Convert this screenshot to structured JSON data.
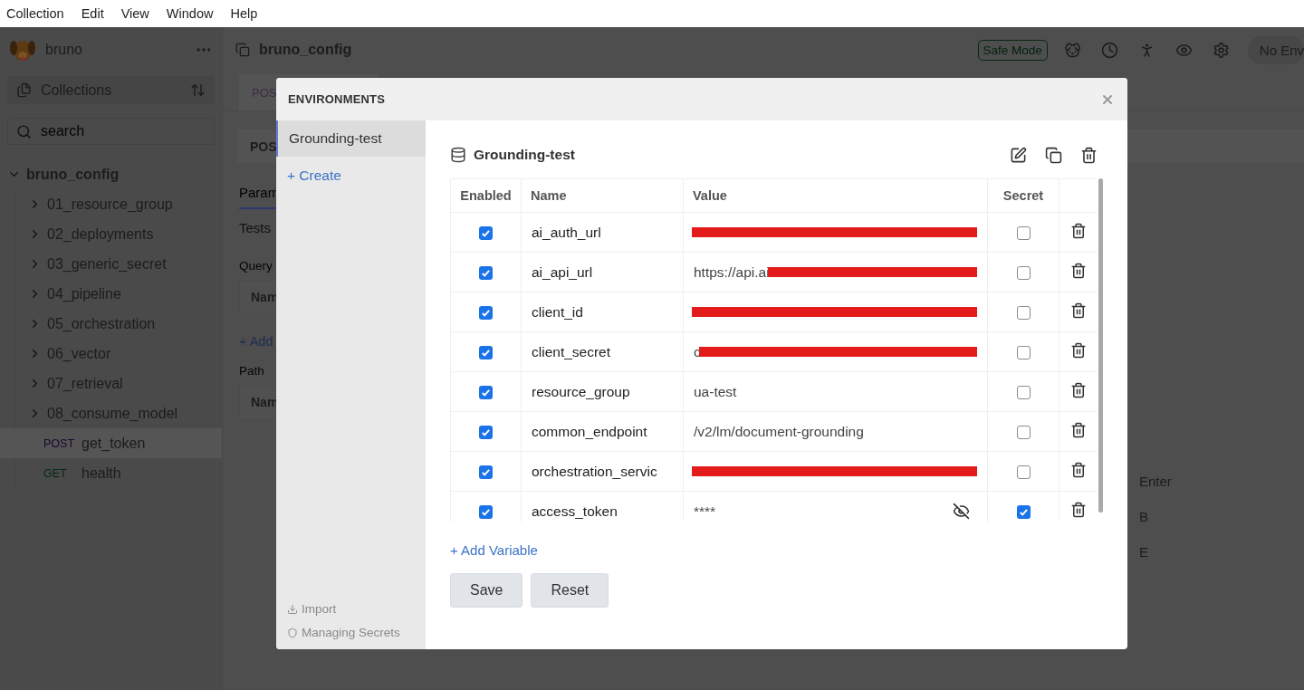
{
  "menu": [
    "Collection",
    "Edit",
    "View",
    "Window",
    "Help"
  ],
  "sidebar": {
    "app_name": "bruno",
    "collections_label": "Collections",
    "search": {
      "placeholder": "search"
    },
    "tree": [
      {
        "label": "bruno_config",
        "expanded": true,
        "children": [
          {
            "kind": "folder",
            "label": "01_resource_group",
            "expanded": false,
            "selected": false
          },
          {
            "kind": "folder",
            "label": "02_deployments",
            "expanded": false,
            "selected": false
          },
          {
            "kind": "folder",
            "label": "03_generic_secret",
            "expanded": false,
            "selected": false
          },
          {
            "kind": "folder",
            "label": "04_pipeline",
            "expanded": false,
            "selected": false
          },
          {
            "kind": "folder",
            "label": "05_orchestration",
            "expanded": false,
            "selected": false
          },
          {
            "kind": "folder",
            "label": "06_vector",
            "expanded": false,
            "selected": false
          },
          {
            "kind": "folder",
            "label": "07_retrieval",
            "expanded": false,
            "selected": false
          },
          {
            "kind": "folder",
            "label": "08_consume_model",
            "expanded": false,
            "selected": false
          },
          {
            "kind": "request",
            "method": "POST",
            "label": "get_token",
            "selected": true
          },
          {
            "kind": "request",
            "method": "GET",
            "label": "health",
            "selected": false
          }
        ]
      }
    ]
  },
  "main": {
    "title": "bruno_config",
    "safe_mode": "Safe Mode",
    "environment": "No Env",
    "request_tab": "POS",
    "url_method": "POS",
    "tabs": [
      {
        "label": "Param",
        "selected": true
      },
      {
        "label": "Tests",
        "selected": false
      }
    ],
    "query_label": "Query",
    "query_header": "Nam",
    "add_param": "+ Add",
    "path_label": "Path",
    "path_header": "Nam",
    "shortcuts": [
      "Enter",
      "B",
      "E"
    ]
  },
  "modal": {
    "title": "ENVIRONMENTS",
    "environments": [
      {
        "label": "Grounding-test",
        "selected": true
      }
    ],
    "create": "+ Create",
    "import": "Import",
    "managing_secrets": "Managing Secrets",
    "environment_name": "Grounding-test",
    "columns": [
      "Enabled",
      "Name",
      "Value",
      "Secret"
    ],
    "variables": [
      {
        "enabled": true,
        "name": "ai_auth_url",
        "redacted": true,
        "secret": false
      },
      {
        "enabled": true,
        "name": "ai_api_url",
        "value": "https://api.ai",
        "redacted": true,
        "secret": false
      },
      {
        "enabled": true,
        "name": "client_id",
        "redacted": true,
        "secret": false
      },
      {
        "enabled": true,
        "name": "client_secret",
        "value": "c",
        "redacted": true,
        "secret": false
      },
      {
        "enabled": true,
        "name": "resource_group",
        "value": "ua-test",
        "redacted": false,
        "secret": false
      },
      {
        "enabled": true,
        "name": "common_endpoint",
        "value": "/v2/lm/document-grounding",
        "redacted": false,
        "secret": false
      },
      {
        "enabled": true,
        "name": "orchestration_servic",
        "redacted": true,
        "secret": false
      },
      {
        "enabled": true,
        "name": "access_token",
        "value": "****",
        "redacted": false,
        "secret": true
      }
    ],
    "add_variable": "+ Add Variable",
    "buttons": [
      "Save",
      "Reset"
    ]
  }
}
